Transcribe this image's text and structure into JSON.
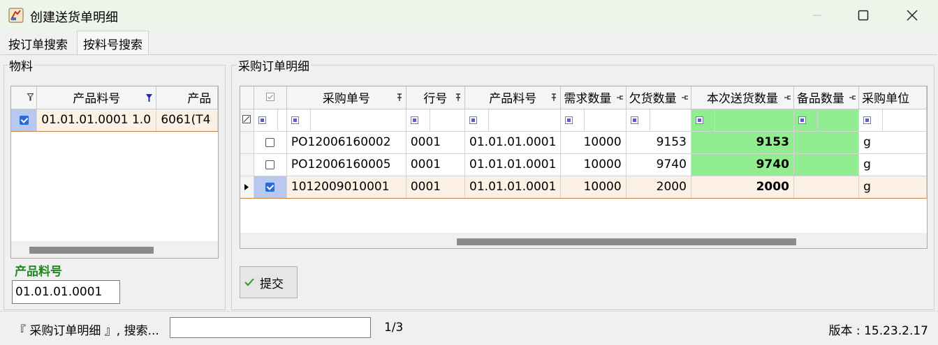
{
  "window": {
    "title": "创建送货单明细"
  },
  "tabs": [
    {
      "label": "按订单搜索"
    },
    {
      "label": "按料号搜索"
    }
  ],
  "material_panel": {
    "group_label": "物料",
    "columns": [
      "产品料号",
      "产品"
    ],
    "rows": [
      {
        "checked": true,
        "code": "01.01.01.0001 1.0",
        "name": "6061(T4"
      }
    ],
    "code_label": "产品料号",
    "code_value": "01.01.01.0001"
  },
  "order_panel": {
    "group_label": "采购订单明细",
    "columns": [
      "采购单号",
      "行号",
      "产品料号",
      "需求数量",
      "欠货数量",
      "本次送货数量",
      "备品数量",
      "采购单位"
    ],
    "rows": [
      {
        "checked": false,
        "po": "PO12006160002",
        "line": "0001",
        "code": "01.01.01.0001",
        "demand": "10000",
        "owed": "9153",
        "deliver": "9153",
        "spare": "",
        "unit": "g"
      },
      {
        "checked": false,
        "po": "PO12006160005",
        "line": "0001",
        "code": "01.01.01.0001",
        "demand": "10000",
        "owed": "9740",
        "deliver": "9740",
        "spare": "",
        "unit": "g"
      },
      {
        "checked": true,
        "po": "1012009010001",
        "line": "0001",
        "code": "01.01.01.0001",
        "demand": "10000",
        "owed": "2000",
        "deliver": "2000",
        "spare": "",
        "unit": "g"
      }
    ],
    "submit_label": "提交"
  },
  "status_bar": {
    "search_label": "『 采购订单明细 』, 搜索...",
    "search_value": "",
    "page": "1/3",
    "version": "版本 : 15.23.2.17"
  },
  "colors": {
    "highlight_green": "#90ee90",
    "code_label_green": "#1f8a1f",
    "selected_row": "#fdf0e4",
    "check_blue": "#2a6bd6"
  }
}
